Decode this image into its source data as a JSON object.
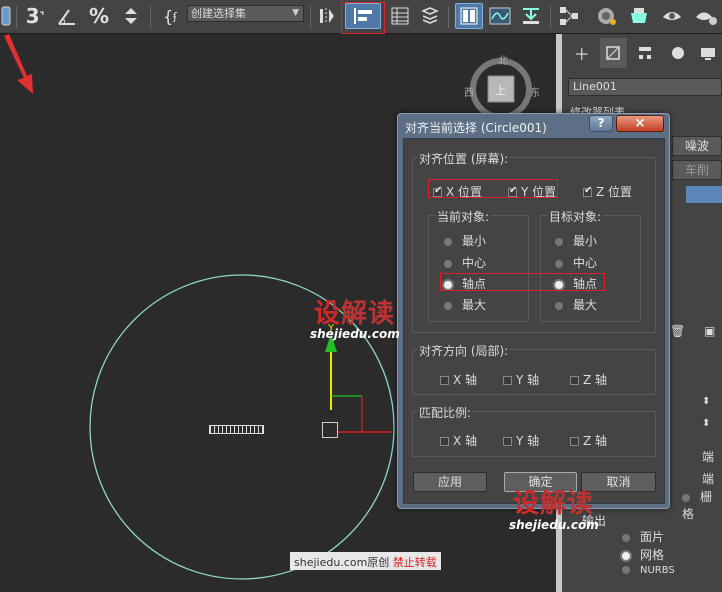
{
  "toolbar": {
    "selection_set_placeholder": "创建选择集",
    "icons": [
      "snap-3-icon",
      "angle-snap-icon",
      "percent-snap-icon",
      "spinner-snap-icon",
      "named-selection-icon",
      "mirror-icon",
      "align-icon",
      "layer-explorer-icon",
      "layers-icon",
      "ribbon-icon",
      "curve-editor-icon",
      "dope-sheet-icon",
      "schematic-icon",
      "material-editor-icon",
      "render-setup-icon",
      "render-frame-icon",
      "render-icon"
    ]
  },
  "viewport": {
    "compass": {
      "north": "北",
      "east": "东",
      "west": "西",
      "top": "上"
    },
    "colors": {
      "circle": "#8fd6c8",
      "y_axis": "#e8e800",
      "x_axis": "#d82020",
      "z_axis": "#20c020",
      "arrow": "#e23030"
    }
  },
  "command_panel": {
    "object_name": "Line001",
    "truncated_row": "修改器列表",
    "noise_button": "噪波",
    "lathe_button": "车削",
    "labels": {
      "end_1": "端",
      "end_2": "端",
      "grid_label": "栅格",
      "output": "输出"
    },
    "output_options": [
      "面片",
      "网格",
      "NURBS"
    ]
  },
  "dialog": {
    "title": "对齐当前选择 (Circle001)",
    "help_button": "?",
    "close_button": "×",
    "align_position": {
      "label": "对齐位置 (屏幕):",
      "x": "X 位置",
      "y": "Y 位置",
      "z": "Z 位置",
      "current_object": {
        "label": "当前对象:",
        "options": [
          "最小",
          "中心",
          "轴点",
          "最大"
        ],
        "selected": "轴点"
      },
      "target_object": {
        "label": "目标对象:",
        "options": [
          "最小",
          "中心",
          "轴点",
          "最大"
        ],
        "selected": "轴点"
      }
    },
    "align_orientation": {
      "label": "对齐方向 (局部):",
      "x": "X 轴",
      "y": "Y 轴",
      "z": "Z 轴"
    },
    "match_scale": {
      "label": "匹配比例:",
      "x": "X 轴",
      "y": "Y 轴",
      "z": "Z 轴"
    },
    "buttons": {
      "apply": "应用",
      "ok": "确定",
      "cancel": "取消"
    }
  },
  "watermark": {
    "logo_1": "设",
    "logo_2": "解读",
    "url": "shejiedu.com",
    "bottom_site": "shejiedu.com原创",
    "bottom_warning": "禁止转载"
  }
}
